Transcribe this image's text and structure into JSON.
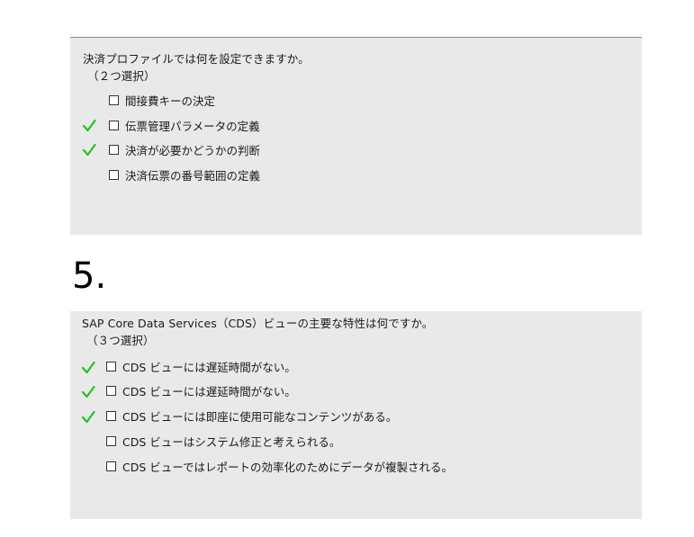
{
  "question1": {
    "prompt": "決済プロファイルでは何を設定できますか。",
    "hint": "（２つ選択）",
    "options": [
      {
        "label": "間接費キーの決定",
        "correct": false
      },
      {
        "label": "伝票管理パラメータの定義",
        "correct": true
      },
      {
        "label": "決済が必要かどうかの判断",
        "correct": true
      },
      {
        "label": "決済伝票の番号範囲の定義",
        "correct": false
      }
    ]
  },
  "question2": {
    "number": "5.",
    "prompt": "SAP Core Data Services（CDS）ビューの主要な特性は何ですか。",
    "hint": "（３つ選択）",
    "options": [
      {
        "label": "CDS ビューには遅延時間がない。",
        "correct": true
      },
      {
        "label": "CDS ビューには遅延時間がない。",
        "correct": true
      },
      {
        "label": "CDS ビューには即座に使用可能なコンテンツがある。",
        "correct": true
      },
      {
        "label": "CDS ビューはシステム修正と考えられる。",
        "correct": false
      },
      {
        "label": "CDS ビューではレポートの効率化のためにデータが複製される。",
        "correct": false
      }
    ]
  },
  "colors": {
    "card_background": "#e9e9e9",
    "check_mark": "#22c41c"
  },
  "icons": {
    "correct_marker": "check-icon",
    "option_box": "checkbox-icon"
  }
}
